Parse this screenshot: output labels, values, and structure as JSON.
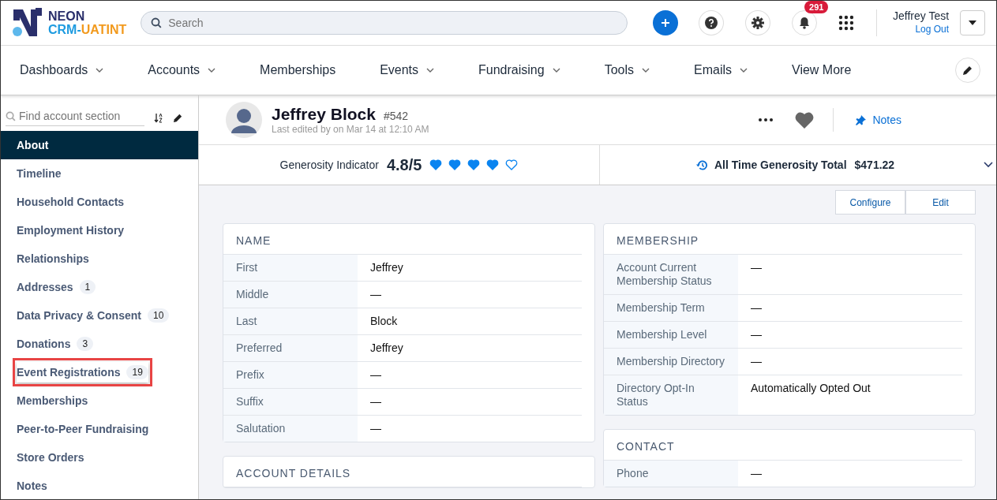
{
  "logo": {
    "line1": "NEON",
    "line2a": "CRM-",
    "line2b": "UATINT"
  },
  "search": {
    "placeholder": "Search"
  },
  "notifications": {
    "count": "291"
  },
  "user": {
    "name": "Jeffrey Test",
    "logout": "Log Out"
  },
  "nav": [
    {
      "label": "Dashboards",
      "dropdown": true
    },
    {
      "label": "Accounts",
      "dropdown": true
    },
    {
      "label": "Memberships",
      "dropdown": false
    },
    {
      "label": "Events",
      "dropdown": true
    },
    {
      "label": "Fundraising",
      "dropdown": true
    },
    {
      "label": "Tools",
      "dropdown": true
    },
    {
      "label": "Emails",
      "dropdown": true
    },
    {
      "label": "View More",
      "dropdown": false
    }
  ],
  "sidebar": {
    "placeholder": "Find account section",
    "items": [
      {
        "label": "About",
        "selected": true,
        "highlighted": false
      },
      {
        "label": "Timeline",
        "selected": false,
        "highlighted": false
      },
      {
        "label": "Household Contacts",
        "selected": false,
        "highlighted": false
      },
      {
        "label": "Employment History",
        "selected": false,
        "highlighted": false
      },
      {
        "label": "Relationships",
        "selected": false,
        "highlighted": false
      },
      {
        "label": "Addresses",
        "count": "1",
        "selected": false,
        "highlighted": false
      },
      {
        "label": "Data Privacy & Consent",
        "count": "10",
        "selected": false,
        "highlighted": false
      },
      {
        "label": "Donations",
        "count": "3",
        "selected": false,
        "highlighted": false
      },
      {
        "label": "Event Registrations",
        "count": "19",
        "selected": false,
        "highlighted": true
      },
      {
        "label": "Memberships",
        "selected": false,
        "highlighted": false
      },
      {
        "label": "Peer-to-Peer Fundraising",
        "selected": false,
        "highlighted": false
      },
      {
        "label": "Store Orders",
        "selected": false,
        "highlighted": false
      },
      {
        "label": "Notes",
        "selected": false,
        "highlighted": false
      }
    ]
  },
  "account": {
    "name": "Jeffrey Block",
    "id": "#542",
    "edited": "Last edited by on Mar 14 at 12:10 AM",
    "notes": "Notes"
  },
  "generosity": {
    "label": "Generosity Indicator",
    "score": "4.8/5",
    "stars": 4,
    "total_label": "All Time Generosity Total",
    "total": "$471.22"
  },
  "actions": [
    "Configure",
    "Edit"
  ],
  "cards_left": [
    {
      "title": "NAME",
      "fields": [
        {
          "label": "First",
          "value": "Jeffrey"
        },
        {
          "label": "Middle",
          "value": "—"
        },
        {
          "label": "Last",
          "value": "Block"
        },
        {
          "label": "Preferred",
          "value": "Jeffrey"
        },
        {
          "label": "Prefix",
          "value": "—"
        },
        {
          "label": "Suffix",
          "value": "—"
        },
        {
          "label": "Salutation",
          "value": "—"
        }
      ]
    },
    {
      "title": "ACCOUNT DETAILS"
    }
  ],
  "cards_right": [
    {
      "title": "MEMBERSHIP",
      "fields": [
        {
          "label": "Account Current Membership Status",
          "value": "—"
        },
        {
          "label": "Membership Term",
          "value": "—"
        },
        {
          "label": "Membership Level",
          "value": "—"
        },
        {
          "label": "Membership Directory",
          "value": "—"
        },
        {
          "label": "Directory Opt-In Status",
          "value": "Automatically Opted Out"
        }
      ]
    },
    {
      "title": "CONTACT",
      "fields": [
        {
          "label": "Phone",
          "value": "—"
        }
      ]
    }
  ]
}
